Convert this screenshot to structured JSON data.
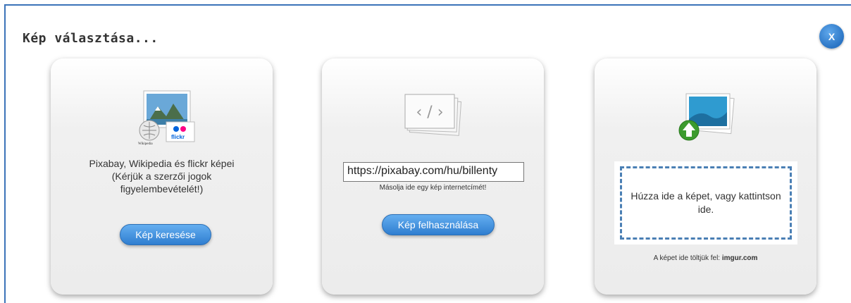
{
  "dialog": {
    "title": "Kép választása...",
    "close_label": "X"
  },
  "cards": {
    "search": {
      "description_line1": "Pixabay, Wikipedia és flickr képei",
      "description_line2": "(Kérjük a szerzői jogok",
      "description_line3": "figyelembevételét!)",
      "wiki_caption": "Wikipedia",
      "flickr_caption": "flickr",
      "button": "Kép keresése"
    },
    "url": {
      "input_value": "https://pixabay.com/hu/billenty",
      "hint": "Másolja ide egy kép internetcímét!",
      "code_glyph": "‹ / ›",
      "button": "Kép felhasználása"
    },
    "upload": {
      "drop_text": "Húzza ide a képet, vagy kattintson ide.",
      "note_prefix": "A képet ide töltjük fel: ",
      "note_site": "imgur.com"
    }
  },
  "colors": {
    "accent": "#2f7ed0",
    "border": "#3b73b9",
    "dash": "#4a7fb4"
  }
}
